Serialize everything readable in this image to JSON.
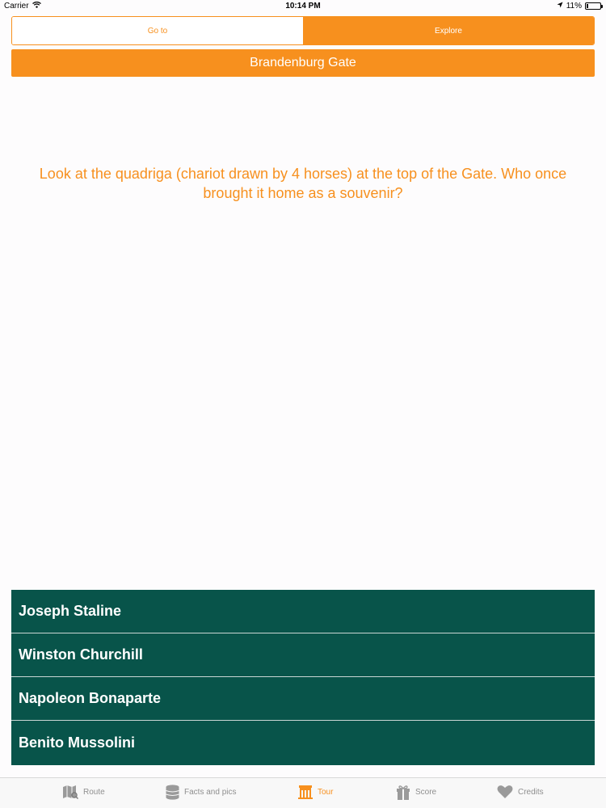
{
  "status_bar": {
    "carrier": "Carrier",
    "time": "10:14 PM",
    "battery": "11%"
  },
  "segmented": {
    "goto_label": "Go to",
    "explore_label": "Explore",
    "selected": "Explore"
  },
  "title": "Brandenburg Gate",
  "question": "Look at the quadriga (chariot drawn by 4 horses) at the top of the Gate. Who once brought it home as a souvenir?",
  "answers": [
    "Joseph Staline",
    "Winston Churchill",
    "Napoleon Bonaparte",
    "Benito Mussolini"
  ],
  "tabs": [
    {
      "label": "Route",
      "icon": "map-icon"
    },
    {
      "label": "Facts and pics",
      "icon": "database-icon"
    },
    {
      "label": "Tour",
      "icon": "building-icon",
      "active": true
    },
    {
      "label": "Score",
      "icon": "gift-icon"
    },
    {
      "label": "Credits",
      "icon": "heart-icon"
    }
  ],
  "colors": {
    "accent": "#f7901e",
    "answer_bg": "#08544a",
    "tab_inactive": "#8f8f8f"
  }
}
